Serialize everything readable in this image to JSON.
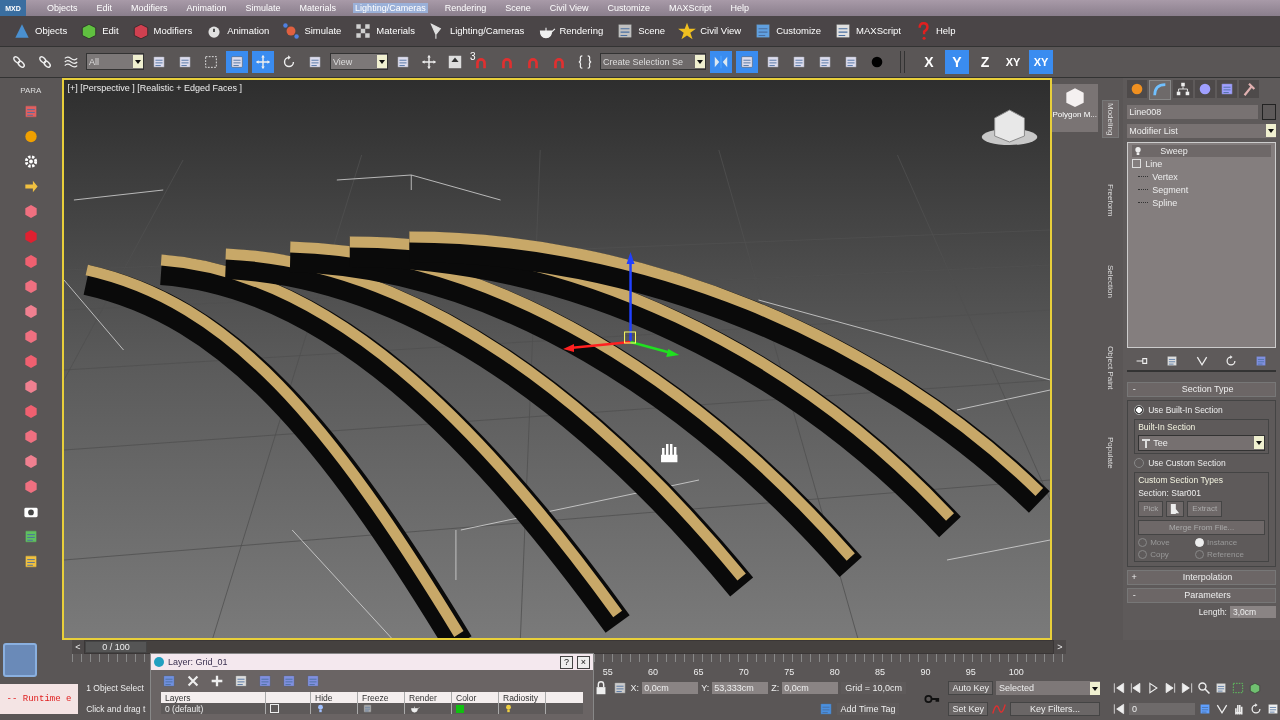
{
  "menu_bar": {
    "logo": "MXD",
    "items": [
      {
        "label": "Objects",
        "selected": false
      },
      {
        "label": "Edit",
        "selected": false
      },
      {
        "label": "Modifiers",
        "selected": false
      },
      {
        "label": "Animation",
        "selected": false
      },
      {
        "label": "Simulate",
        "selected": false
      },
      {
        "label": "Materials",
        "selected": false
      },
      {
        "label": "Lighting/Cameras",
        "selected": true
      },
      {
        "label": "Rendering",
        "selected": false
      },
      {
        "label": "Scene",
        "selected": false
      },
      {
        "label": "Civil View",
        "selected": false
      },
      {
        "label": "Customize",
        "selected": false
      },
      {
        "label": "MAXScript",
        "selected": false
      },
      {
        "label": "Help",
        "selected": false
      }
    ]
  },
  "ribbon": {
    "items": [
      "Objects",
      "Edit",
      "Modifiers",
      "Animation",
      "Simulate",
      "Materials",
      "Lighting/Cameras",
      "Rendering",
      "Scene",
      "Civil View",
      "Customize",
      "MAXScript",
      "Help"
    ]
  },
  "toolbar": {
    "selection_filter": "All",
    "reference_coord": "View",
    "selection_set": "Create Selection Se",
    "snap_label": "3",
    "tools": [
      {
        "selected": false
      },
      {
        "selected": false
      },
      {
        "selected": false
      },
      {
        "selected": false
      },
      {
        "selected": false
      },
      {
        "selected": false
      },
      {
        "selected": true
      },
      {
        "selected": true
      },
      {
        "selected": false
      },
      {
        "selected": false
      },
      {
        "selected": false
      },
      {
        "selected": false
      },
      {
        "selected": false
      },
      {
        "selected": false
      },
      {
        "selected": false
      },
      {
        "selected": false
      },
      {
        "selected": false
      },
      {
        "selected": false
      },
      {
        "selected": true
      },
      {
        "selected": true
      },
      {
        "selected": false
      },
      {
        "selected": false
      },
      {
        "selected": false
      },
      {
        "selected": false
      },
      {
        "selected": false
      }
    ],
    "axes": [
      {
        "label": "X",
        "selected": false
      },
      {
        "label": "Y",
        "selected": true
      },
      {
        "label": "Z",
        "selected": false
      },
      {
        "label": "XY",
        "selected": false
      },
      {
        "label": "XY",
        "selected": true
      }
    ]
  },
  "left_toolbar": {
    "label": "PARA"
  },
  "viewport": {
    "label": "[+] [Perspective ] [Realistic + Edged Faces ]"
  },
  "modeling_ribbon": {
    "tile": "Polygon M...",
    "tabs": [
      {
        "label": "Modeling",
        "selected": true
      },
      {
        "label": "Freeform",
        "selected": false
      },
      {
        "label": "Selection",
        "selected": false
      },
      {
        "label": "Object Paint",
        "selected": false
      },
      {
        "label": "Populate",
        "selected": false
      }
    ]
  },
  "command_panel": {
    "tabs": [
      {
        "selected": false
      },
      {
        "selected": true
      },
      {
        "selected": false
      },
      {
        "selected": false
      },
      {
        "selected": false
      },
      {
        "selected": false
      }
    ],
    "object_name": "Line008",
    "modifier_list": "Modifier List",
    "stack": [
      {
        "label": "Sweep"
      },
      {
        "label": "Line",
        "children": [
          {
            "label": "Vertex"
          },
          {
            "label": "Segment"
          },
          {
            "label": "Spline"
          }
        ]
      }
    ],
    "section_type": {
      "sign": "-",
      "title": "Section Type",
      "options": [
        {
          "label": "Use Built-In Section",
          "selected": true
        },
        {
          "label": "Use Custom Section",
          "selected": false
        }
      ],
      "builtin_group": "Built-In Section",
      "builtin_value": "Tee",
      "custom_group": "Custom Section Types",
      "section": "Section: Star001",
      "pick": "Pick",
      "extract": "Extract",
      "merge": "Merge From File...",
      "modes": [
        {
          "label": "Move",
          "selected": false
        },
        {
          "label": "Instance",
          "selected": true
        },
        {
          "label": "Copy",
          "selected": false
        },
        {
          "label": "Reference",
          "selected": false
        }
      ]
    },
    "interpolation": {
      "sign": "+",
      "title": "Interpolation"
    },
    "parameters": {
      "sign": "-",
      "title": "Parameters",
      "length_label": "Length:",
      "length": "3,0cm"
    }
  },
  "time_slider": {
    "prev": "<",
    "label": "0 / 100",
    "next": ">"
  },
  "ruler": [
    "55",
    "60",
    "65",
    "70",
    "75",
    "80",
    "85",
    "90",
    "95",
    "100"
  ],
  "status": {
    "listener": "-- Runtime e",
    "selection_info": "1 Object Select",
    "prompt": "Click and drag t",
    "coords": [
      {
        "axis": "X:",
        "value": "0,0cm"
      },
      {
        "axis": "Y:",
        "value": "53,333cm"
      },
      {
        "axis": "Z:",
        "value": "0,0cm"
      }
    ],
    "grid": "Grid = 10,0cm",
    "time_tag": "Add Time Tag",
    "auto_key": "Auto Key",
    "key_mode": "Selected",
    "set_key": "Set Key",
    "key_filters": "Key Filters...",
    "frame": "0"
  },
  "layer_dialog": {
    "title": "Layer: Grid_01",
    "help": "?",
    "close": "×",
    "columns": [
      "Layers",
      "Hide",
      "Freeze",
      "Render",
      "Color",
      "Radiosity"
    ],
    "rows": [
      {
        "name": "0 (default)",
        "checked": false,
        "color": "#10c010"
      }
    ]
  }
}
